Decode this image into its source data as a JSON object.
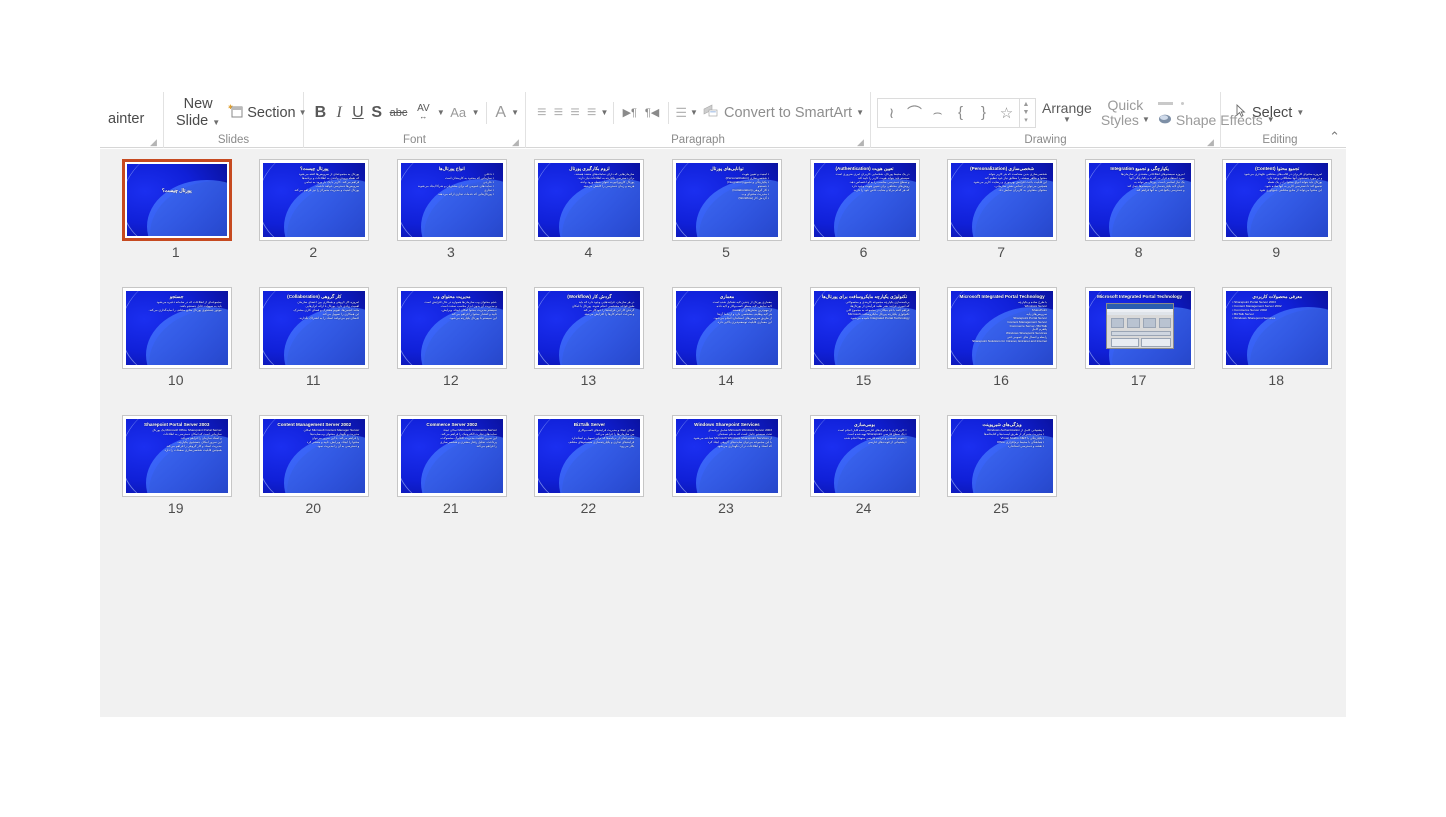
{
  "app": {
    "name": "PowerPoint Slide Sorter",
    "accent_selected": "#c64a20",
    "workspace_bg": "#f1f1f1"
  },
  "ribbon": {
    "groups": [
      {
        "id": "clipboard",
        "label": "",
        "items": [
          {
            "name": "format-painter",
            "label": "ainter"
          }
        ]
      },
      {
        "id": "slides",
        "label": "Slides",
        "items": [
          {
            "name": "new-slide",
            "label": "New",
            "label2": "Slide"
          },
          {
            "name": "section",
            "label": "Section"
          }
        ]
      },
      {
        "id": "font",
        "label": "Font",
        "items": [
          {
            "name": "bold",
            "label": "B"
          },
          {
            "name": "italic",
            "label": "I"
          },
          {
            "name": "underline",
            "label": "U"
          },
          {
            "name": "shadow",
            "label": "S"
          },
          {
            "name": "strikethrough",
            "label": "abc"
          },
          {
            "name": "character-spacing",
            "label": "AV"
          },
          {
            "name": "change-case",
            "label": "Aa"
          },
          {
            "name": "font-color",
            "label": "A"
          }
        ]
      },
      {
        "id": "paragraph",
        "label": "Paragraph",
        "items": [
          {
            "name": "align-left",
            "label": "≡"
          },
          {
            "name": "align-center",
            "label": "≡"
          },
          {
            "name": "align-right",
            "label": "≡"
          },
          {
            "name": "justify",
            "label": "≡"
          },
          {
            "name": "text-direction-ltr",
            "label": "▶¶"
          },
          {
            "name": "text-direction-rtl",
            "label": "¶◀"
          },
          {
            "name": "columns",
            "label": "☰"
          },
          {
            "name": "convert-to-smartart",
            "label": "Convert to SmartArt"
          }
        ]
      },
      {
        "id": "drawing",
        "label": "Drawing",
        "items": [
          {
            "name": "shape-scribble",
            "label": "≀"
          },
          {
            "name": "shape-arc",
            "label": "⌒"
          },
          {
            "name": "shape-curve",
            "label": "⌢"
          },
          {
            "name": "shape-left-brace",
            "label": "{"
          },
          {
            "name": "shape-right-brace",
            "label": "}"
          },
          {
            "name": "shape-star",
            "label": "☆"
          },
          {
            "name": "arrange",
            "label": "Arrange"
          },
          {
            "name": "quick-styles",
            "label": "Quick",
            "label2": "Styles"
          },
          {
            "name": "shape-effects",
            "label": "Shape Effects"
          }
        ]
      },
      {
        "id": "editing",
        "label": "Editing",
        "items": [
          {
            "name": "select",
            "label": "Select"
          }
        ]
      }
    ],
    "collapse_label": "⌃"
  },
  "slides": {
    "rows": [
      [
        {
          "num": "9",
          "selected": false,
          "dir": "rtl",
          "title": "تجمیع محتوا (Content)",
          "body": [
            "امروزه محتوای کاربران در قالب‌های مختلفی نگهداری می‌شود",
            "و در مورد جستجوی آنها مشکلاتی وجود دارد.",
            "پورتال باید بتواند انواع محتوا را در یک نقطه",
            "تجمیع کند تا دسترسی کاربر به آنها ساده شود.",
            "این محتوا می‌تواند از منابع مختلفی جمع‌آوری شود."
          ]
        },
        {
          "num": "8",
          "selected": false,
          "dir": "rtl",
          "title": "یکپارچگی و تجمیع Integration",
          "body": [
            "امروزه سیستم‌های اطلاعاتی متعددی در سازمان‌ها",
            "مورد استفاده قرار می‌گیرند و یکپارچگی آنها",
            "یک نیاز اساسی است. پورتال می‌تواند به",
            "عنوان لایه یکپارچه‌ساز این سیستم‌ها عمل کند",
            "و دسترسی یکنواختی به آنها فراهم کند."
          ]
        },
        {
          "num": "7",
          "selected": false,
          "dir": "rtl",
          "title": "شخصی‌سازی (Personalization)",
          "body": [
            "شخصی‌سازی بدین معناست که هر کاربر بتواند",
            "محتوا و ظاهر صفحه را مطابق نیاز خود تنظیم کند.",
            "این قابلیت باعث افزایش بهره‌وری و رضایت کاربر می‌شود.",
            "همچنین می‌توان بر اساس نقش سازمانی،",
            "محتوای متفاوتی به کاربران نمایش داد."
          ]
        },
        {
          "num": "6",
          "selected": false,
          "dir": "rtl",
          "title": "تعیین هویت (Authentication)",
          "body": [
            "در یک محیط پورتال، شناسایی کاربران امری ضروری است.",
            "سیستم باید بتواند هویت کاربر را تایید کند",
            "و سطح دسترسی مناسب را به او اختصاص دهد.",
            "روش‌های مختلفی برای تعیین هویت وجود دارد",
            "که هر کدام مزایا و معایب خاص خود را دارند."
          ]
        },
        {
          "num": "5",
          "selected": false,
          "dir": "rtl",
          "title": "توانایی‌های پورتال",
          "bullets": true,
          "body": [
            "امنیت و تعیین هویت",
            "شخصی‌سازی (Personalization)",
            "یکپارچگی و تجمیع (Integration)",
            "جستجو",
            "کار گروهی (Collaboration)",
            "مدیریت محتوای وب",
            "گردش کار (Workflow)"
          ]
        },
        {
          "num": "4",
          "selected": false,
          "dir": "rtl",
          "title": "لزوم بکارگیری پورتال",
          "body": [
            "سازمان‌هایی که دارای سامانه‌های متعدد هستند،",
            "برای دسترسی یکپارچه به اطلاعات نیاز دارند.",
            "پورتال کارپوراتیو به عنوان نقطه ورود واحد،",
            "هزینه و زمان دسترسی را کاهش می‌دهد."
          ]
        },
        {
          "num": "3",
          "selected": false,
          "dir": "rtl",
          "title": "انواع پورتال‌ها",
          "bullets": true,
          "body": [
            "داخلی",
            "سازمانی که محدود به کارمندان است",
            "خارجی",
            "سایت‌های عمومی که برای مشتریان و شرکا ایجاد می‌شوند",
            "تجاری",
            "پورتال‌هایی که خدمات تجاری ارائه می‌دهند"
          ]
        },
        {
          "num": "2",
          "selected": false,
          "dir": "rtl",
          "title": "پورتال چیست؟",
          "body": [
            "پورتال به مجموعه‌ای از سرویس‌ها گفته می‌شود",
            "که نقطه ورودی واحدی به اطلاعات و برنامه‌ها",
            "فراهم می‌کند. کاربر با یک بار ورود به تمامی",
            "سرویس‌ها دسترسی خواهد داشت.",
            "پورتال امنیت و مدیریت متمرکز را نیز فراهم می‌کند."
          ]
        },
        {
          "num": "1",
          "selected": true,
          "dir": "rtl",
          "title_only": true,
          "title": "پورتال چیست؟",
          "body": []
        }
      ],
      [
        {
          "num": "18",
          "selected": false,
          "dir": "rtl",
          "title": "معرفی محصولات کاربردی",
          "bullets": true,
          "body_ltr": true,
          "body": [
            "Sharepoint Portal Server 2003",
            "Content Management Server 2002",
            "Commerce Server 2002",
            "BizTalk Server",
            "Windows Sharepoint Services"
          ]
        },
        {
          "num": "17",
          "selected": false,
          "dir": "ltr",
          "title_ltr": true,
          "title": "Microsoft Integrated Portal Technology",
          "screenshot": true,
          "body": []
        },
        {
          "num": "16",
          "selected": false,
          "dir": "ltr",
          "title_ltr": true,
          "title": "Microsoft Integrated Portal Technology",
          "body": [
            "با طرح ساده و یکپارچه",
            "Windows Server",
            "SharePoint",
            "سرویس‌های پایه",
            "Sharepoint Portal Server",
            "Content Management Server",
            "Commerce Server / BizTalk",
            "پلتفرم کامل",
            "Windows Sharepoint Services",
            "رابطه و اتصال های عمومی فنی",
            "Sharepoint Solutions for Intranet, Extranet and Internet"
          ]
        },
        {
          "num": "15",
          "selected": false,
          "dir": "rtl",
          "title": "تکنولوژی یکپارچه مایکروسافت برای پورتال‌ها",
          "body": [
            "برنامه‌سازی یکپارچه مجموعه کاربندی و محصولاتی",
            "که اموری فرایند نشر طلبد فرآیندی از پورتال‌ها،",
            "فراهم کنند با نام میکان در مجموعه به مجموع کلی",
            "تکنولوژی یکپارچه پورتال مایکروسافت Microsoft",
            "Integrated Portal Technology نامیده می‌شود."
          ]
        },
        {
          "num": "14",
          "selected": false,
          "dir": "rtl",
          "title": "معماری",
          "body": [
            "معماری پورتال از چندین لایه تشکیل شده است.",
            "لایه نمایش، لایه منطق کسب‌وکار و لایه داده",
            "از مهم‌ترین بخش‌های آن هستند.",
            "هر لایه وظایف مشخصی دارد و ارتباط آن‌ها",
            "از طریق سرویس‌های استاندارد انجام می‌شود.",
            "این معماری قابلیت توسعه‌پذیری بالایی دارد."
          ]
        },
        {
          "num": "13",
          "selected": false,
          "dir": "rtl",
          "title": "گردش کار (Workflow)",
          "body": [
            "در هر سازمان، فرایندهایی وجود دارد که باید",
            "طبق قواعد مشخصی انجام شوند. پورتال با امکان",
            "گردش کار این فرایندها را خودکار می‌کند",
            "و سرعت انجام کارها را افزایش می‌دهد."
          ]
        },
        {
          "num": "12",
          "selected": false,
          "dir": "rtl",
          "title": "مدیریت محتوای وب",
          "body": [
            "حجم محتوای وب سازمان‌ها همواره در حال افزایش است",
            "و مدیریت آن بدون ابزار مناسب سخت است.",
            "سیستم مدیریت محتوا امکان ایجاد، ویرایش،",
            "تایید و انتشار محتوا را فراهم می‌کند.",
            "این سیستم با پورتال یکپارچه می‌شود."
          ]
        },
        {
          "num": "11",
          "selected": false,
          "dir": "rtl",
          "title": "کار گروهی (Collaboration)",
          "body": [
            "امروزه کار گروهی و همکاری بین اعضای سازمان",
            "اهمیت زیادی دارد. پورتال با ارائه ابزارهایی",
            "مانند انجمن‌ها، تقویم مشترک و فضای کاری مشترک،",
            "این همکاری را تسهیل می‌کند.",
            "اعضای تیم می‌توانند اسناد را به اشتراک بگذارند."
          ]
        },
        {
          "num": "10",
          "selected": false,
          "dir": "rtl",
          "title": "جستجو",
          "body": [
            "مجموعه‌ای از اطلاعات که در سامانه ذخیره می‌شود",
            "باید به سهولت قابل جستجو باشد.",
            "موتور جستجوی پورتال منابع مختلف را نمایه‌گذاری می‌کند."
          ]
        }
      ],
      [
        {
          "empty": true
        },
        {
          "empty": true
        },
        {
          "num": "25",
          "selected": false,
          "dir": "rtl",
          "title": "ویژگی‌های شیرپوینت",
          "bullets": true,
          "body": [
            "پشتیبانی کامل از Windows Authentication",
            "مدیریت متمرکز از طریق لیست‌ها و کتابخانه‌ها",
            "یکپارچگی با Visual Studio .NET",
            "هماهنگی با محیط نرم‌افزاری Office",
            "نقشه و دسترسی استاندارد"
          ]
        },
        {
          "num": "24",
          "selected": false,
          "dir": "rtl",
          "title": "بومی‌سازی",
          "bullets": true,
          "body": [
            "کاربرکاری با دیالوگ‌های فارسی‌شده قابل انجام است",
            "یک سطح فارسی Sharepoint تهیه شده است",
            "تقویم شمسی و ترجمه فارسی منوها انجام شده",
            "پشتیبانی از فونت‌های فارسی"
          ]
        },
        {
          "num": "23",
          "selected": false,
          "dir": "ltr",
          "title_ltr": true,
          "title": "Windows Sharepoint Services",
          "body": [
            "Microsoft Windows Server 2003 شامل برنامه‌ای",
            "تحت سیستم عامل است که به نام نسخه‌ای",
            "از Microsoft Windows Sharepoint Services شناخته می‌شود.",
            "با این مجموعه می‌توان سایت‌های گروهی ایجاد کرد",
            "که اسناد و اطلاعات در آن نگهداری می‌شود."
          ]
        },
        {
          "num": "22",
          "selected": false,
          "dir": "ltr",
          "title_ltr": true,
          "title": "BizTalk Server",
          "body": [
            "امکان ایجاد و مدیریت فرایندهای کسب‌وکاری",
            "بین سازمان‌ها را فراهم می‌کند.",
            "مجموعه‌ای از برنامه‌ها که برای تسهیل و استاندارد",
            "فرایندهای تجاری و یکپارچه‌سازی سیستم‌های مختلف",
            "بکار می‌رود."
          ]
        },
        {
          "num": "21",
          "selected": false,
          "dir": "ltr",
          "title_ltr": true,
          "title": "Commerce Server 2002",
          "body": [
            "Microsoft Commerce Server امکان ایجاد",
            "سایت‌های تجارت الکترونیک را فراهم می‌کند.",
            "این سرور قابلیت مدیریت کاتالوگ محصولات،",
            "پرداخت، تحلیل رفتار مشتری و شخصی‌سازی",
            "را فراهم می‌کند."
          ]
        },
        {
          "num": "20",
          "selected": false,
          "dir": "ltr",
          "title_ltr": true,
          "title": "Content Management Server 2002",
          "body": [
            "Microsoft Content Manager Server امکان",
            "مدیریت و نگهداری محتوای وب‌سایت‌ها",
            "را فراهم می‌کند. با این سرور می‌توان",
            "محتوا را ایجاد، ویرایش، تایید و منتشر کرد",
            "و دسترسی به آن را مدیریت نمود."
          ]
        },
        {
          "num": "19",
          "selected": false,
          "dir": "ltr",
          "title_ltr": true,
          "title": "Sharepoint Portal Server 2003",
          "body": [
            "Microsoft Office Sharepoint Portal Server یک پورتال",
            "سازمانی است که امکان دسترسی به اطلاعات",
            "و اسناد سازمان را فراهم می‌کند.",
            "این سرور امکان جستجوی یکپارچه،",
            "مدیریت اسناد و کار گروهی را فراهم می‌کند.",
            "همچنین قابلیت شخصی‌سازی صفحات را دارد."
          ]
        }
      ]
    ]
  }
}
